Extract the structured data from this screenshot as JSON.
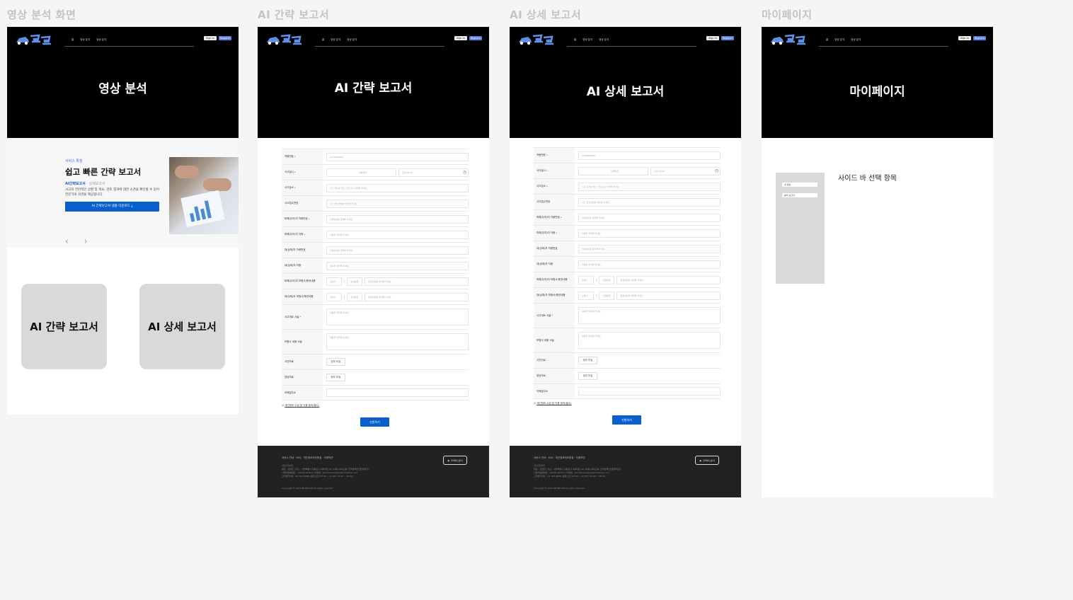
{
  "frames": [
    {
      "title": "영상 분석 화면"
    },
    {
      "title": "AI 간략 보고서"
    },
    {
      "title": "AI 상세 보고서"
    },
    {
      "title": "마이페이지"
    }
  ],
  "header": {
    "nav": [
      "홈",
      "영상 분석",
      "영상 분석"
    ],
    "signin": "Sign In",
    "register": "Register"
  },
  "analysis": {
    "hero_title": "영상 분석",
    "promo": {
      "kicker": "서비스 특징",
      "title": "쉽고 빠른 간략 보고서",
      "tab_active": "AI간략보고서",
      "tab_sep": "·",
      "tab_inactive": "상세보고서",
      "description": "사고의 전반적인 상황 및 개요, 검토 결과에 대한 소견을 확인할 수 있어 전문가의 의견을 제공합니다.",
      "button": "AI 간략보고서 샘플 다운로드  ⤓",
      "prev": "‹",
      "next": "›"
    },
    "card_brief": "AI 간략 보고서",
    "card_detail": "AI 상세 보고서"
  },
  "brief": {
    "hero_title": "AI 간략 보고서"
  },
  "detail": {
    "hero_title": "AI 상세 보고서"
  },
  "form": {
    "labels": {
      "car_number": "차량번호",
      "accident_datetime": "사고일시",
      "accident_place": "사고장소",
      "accident_receipt": "사고접수번호",
      "my_car_number": "피해(우리)차 차량번호",
      "my_car_type": "피해(우리)차 차종",
      "other_car_number": "대(상대)차 차량번호",
      "other_car_type": "대(상대)차 차종",
      "my_insurance": "피해(우리)차 보험사/증권내용",
      "other_insurance": "대(상대)차 보험사/증권내용",
      "accident_summary": "사고개요 서술",
      "insurance_detail": "보험사 내용 서술",
      "photo": "사진자료",
      "video": "영상자료",
      "email": "이메일주소"
    },
    "placeholders": {
      "car_number": "0158900026",
      "date": "날짜입력",
      "time": "오전 00:00",
      "accident_place": "사고 장소를 주소 기입 또는 입력해 주세요.",
      "accident_receipt": "사고 접수번호를 입력해 주세요.",
      "my_car_number": "차량번호를 입력해 주세요.",
      "my_car_type": "차종을 입력해 주세요.",
      "other_car_number": "차량번호를 입력해 주세요.",
      "other_car_type": "차종을 입력해 주세요.",
      "insurance_company": "보험사",
      "insurance_type": "보험종류",
      "insurance_number": "증권번호를 입력해 주세요.",
      "summary": "내용을 입력해 주세요.",
      "detail": "내용을 입력해 주세요.",
      "email": ""
    },
    "attach_label": "첨부 파일",
    "separator": "/",
    "agree": "개인정보 수집 및 이용 동의(필수)",
    "submit": "신청하기"
  },
  "footer": {
    "links": "서비스 안내 · FAQ · 개인정보처리방침 · 이용약관",
    "info_lines": [
      "(주)인피니티",
      "대표 : 김정민 | 주소 : 서울특별시 영등포구 여의대로 24, 46층 (여의도동, 전국경제인연합회회관)",
      "사업자등록번호 : 120-81-90323 | 이메일 : blackboxanalysis@infinitive.co.kr",
      "고객센터번호 : 02-794-9688 (평일 오전 09:00 ~ 12:00 / 13:00 ~ 18:00)"
    ],
    "copyright": "Copyright © 2023 INFINITIVE All rights reserved",
    "badge": "블랙박스분석"
  },
  "mypage": {
    "hero_title": "마이페이지",
    "side_items": [
      "내 정보",
      "분석 보고서"
    ],
    "side_heading": "사이드 바 선택 항목"
  },
  "colors": {
    "accent_blue": "#0a5fcc",
    "register_blue": "#5d7fe0",
    "hero_bg": "#000000",
    "footer_bg": "#222222",
    "card_grey": "#d9d9d9"
  }
}
